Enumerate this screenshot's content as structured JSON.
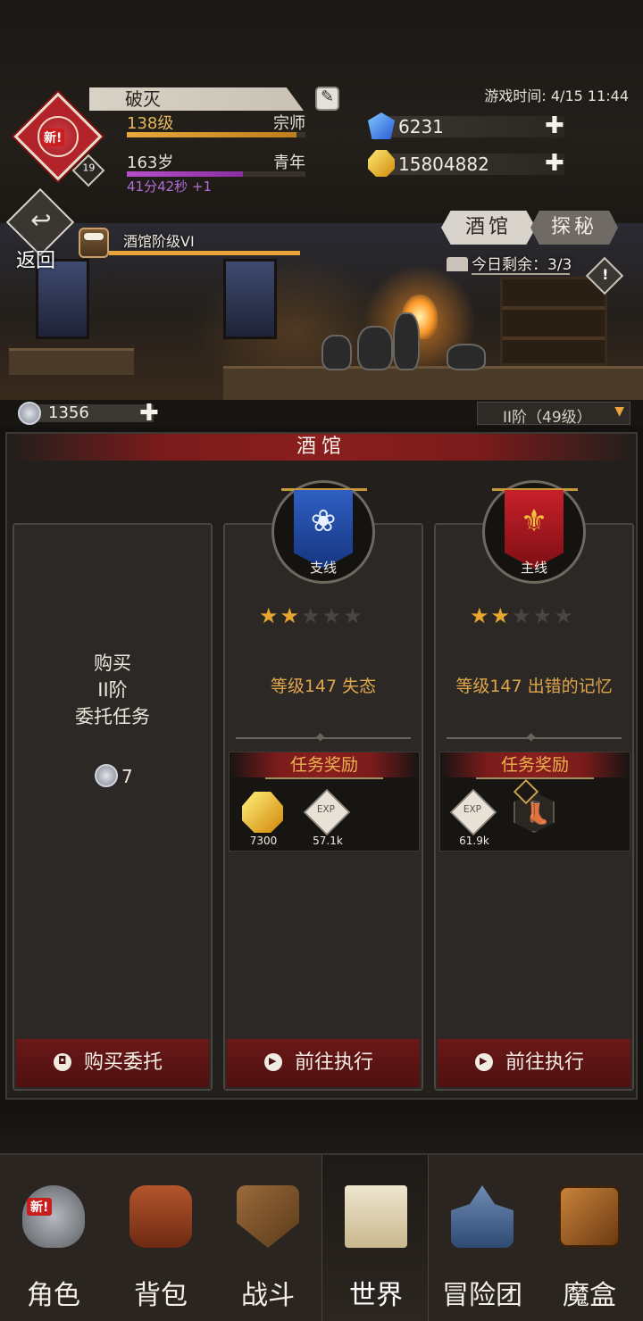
{
  "player": {
    "name": "破灭",
    "level": "138级",
    "rank": "宗师",
    "level_progress": 0.95,
    "age": "163岁",
    "age_stage": "青年",
    "age_progress": 0.65,
    "timer": "41分42秒 +1",
    "new_tag": "新!",
    "badge_level": "19"
  },
  "game_time": "游戏时间: 4/15 11:44",
  "currency": {
    "crystal": "6231",
    "gold": "15804882",
    "plus": "✚"
  },
  "scene": {
    "return_label": "返回",
    "tavern_level": "酒馆阶级VI",
    "tabs": [
      {
        "label": "酒馆",
        "active": true
      },
      {
        "label": "探秘",
        "active": false
      }
    ],
    "remaining": "今日剩余：3/3"
  },
  "tokens": {
    "balance": "1356",
    "plus": "✚",
    "tier": "II阶（49级）",
    "tier_arrow": "▼"
  },
  "panel": {
    "title": "酒馆",
    "buy_card": {
      "line1": "购买",
      "line2": "II阶",
      "line3": "委托任务",
      "cost": "7",
      "action": "购买委托"
    },
    "side_card": {
      "tag": "支线",
      "stars_on": "★★",
      "stars_off": "★★★",
      "title": "等级147 失态",
      "rewards_header": "任务奖励",
      "rewards": [
        {
          "type": "gold",
          "count": "7300"
        },
        {
          "type": "exp",
          "count": "57.1k"
        }
      ],
      "action": "前往执行"
    },
    "main_card": {
      "tag": "主线",
      "stars_on": "★★",
      "stars_off": "★★★",
      "title": "等级147 出错的记忆",
      "rewards_header": "任务奖励",
      "rewards": [
        {
          "type": "exp",
          "count": "61.9k"
        },
        {
          "type": "boots",
          "count": ""
        }
      ],
      "action": "前往执行"
    }
  },
  "nav": {
    "items": [
      {
        "label": "角色",
        "icon": "helmet-icon",
        "badge": "新!"
      },
      {
        "label": "背包",
        "icon": "backpack-icon"
      },
      {
        "label": "战斗",
        "icon": "sword-shield-icon"
      },
      {
        "label": "世界",
        "icon": "scroll-icon",
        "active": true
      },
      {
        "label": "冒险团",
        "icon": "castle-icon"
      },
      {
        "label": "魔盒",
        "icon": "magic-box-icon"
      }
    ]
  }
}
